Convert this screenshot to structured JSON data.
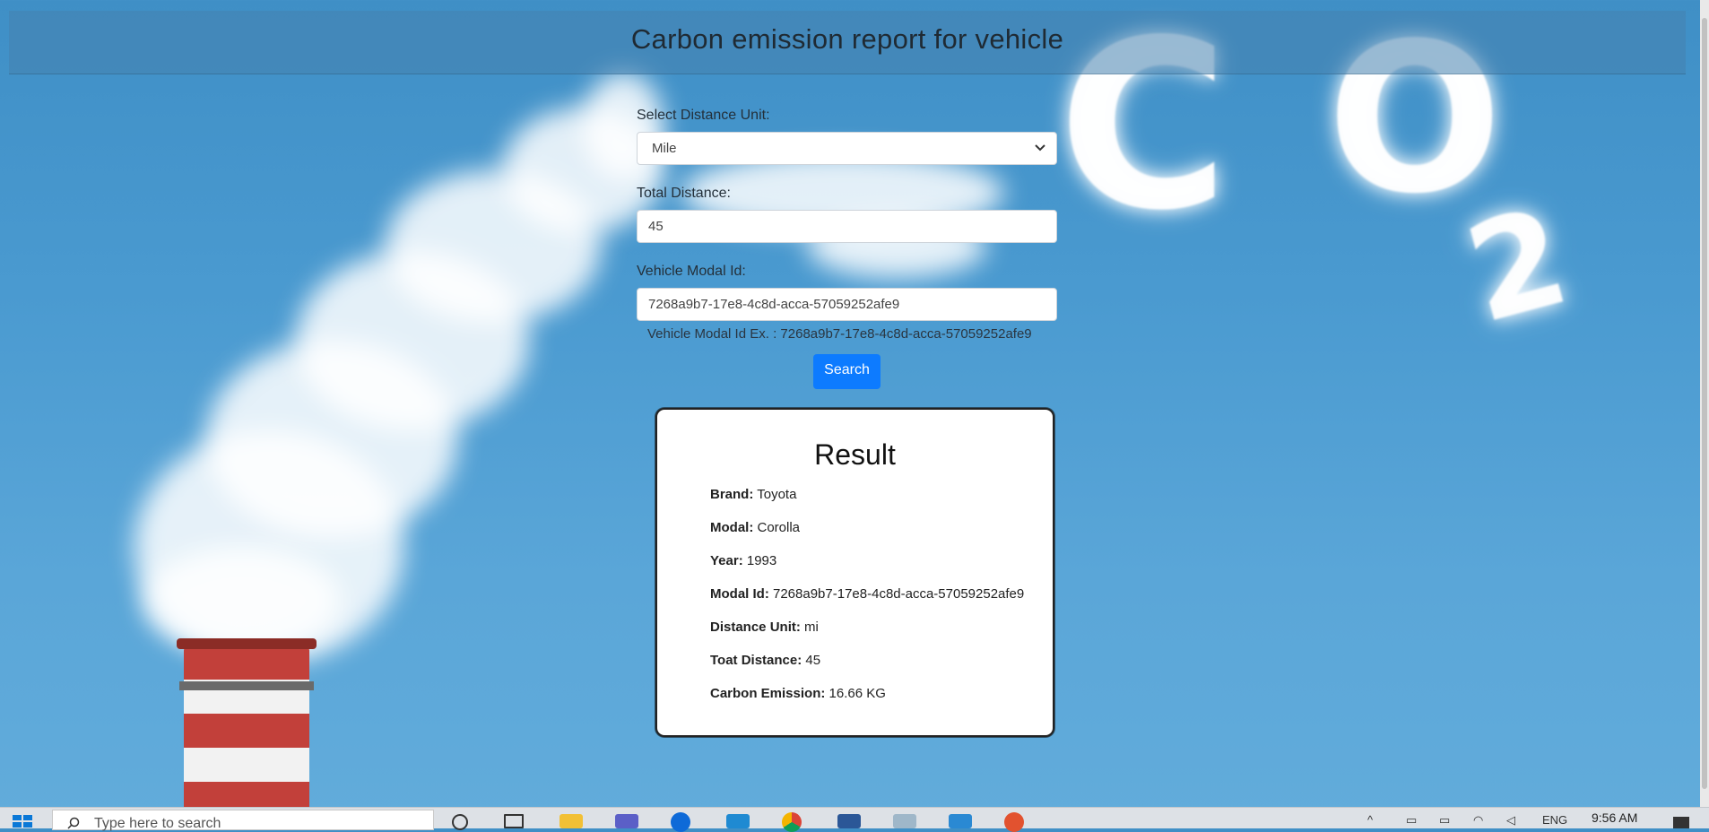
{
  "page": {
    "title": "Carbon emission report for vehicle"
  },
  "form": {
    "distance_unit": {
      "label": "Select Distance Unit:",
      "selected": "Mile"
    },
    "total_distance": {
      "label": "Total Distance:",
      "value": "45"
    },
    "vehicle_model": {
      "label": "Vehicle Modal Id:",
      "value": "7268a9b7-17e8-4c8d-acca-57059252afe9",
      "helper": "Vehicle Modal Id Ex. : 7268a9b7-17e8-4c8d-acca-57059252afe9"
    },
    "search_label": "Search"
  },
  "result": {
    "title": "Result",
    "rows": [
      {
        "label": "Brand:",
        "value": "Toyota"
      },
      {
        "label": "Modal:",
        "value": "Corolla"
      },
      {
        "label": "Year:",
        "value": "1993"
      },
      {
        "label": "Modal Id:",
        "value": "7268a9b7-17e8-4c8d-acca-57059252afe9"
      },
      {
        "label": "Distance Unit:",
        "value": "mi"
      },
      {
        "label": "Toat Distance:",
        "value": "45"
      },
      {
        "label": "Carbon Emission:",
        "value": "16.66 KG"
      }
    ]
  },
  "background": {
    "co2_letters": [
      "C",
      "O",
      "2"
    ]
  },
  "taskbar": {
    "search_placeholder": "Type here to search",
    "language": "ENG",
    "time": "9:56 AM"
  },
  "colors": {
    "accent": "#0d7bff",
    "background": "#4a9ad0"
  }
}
